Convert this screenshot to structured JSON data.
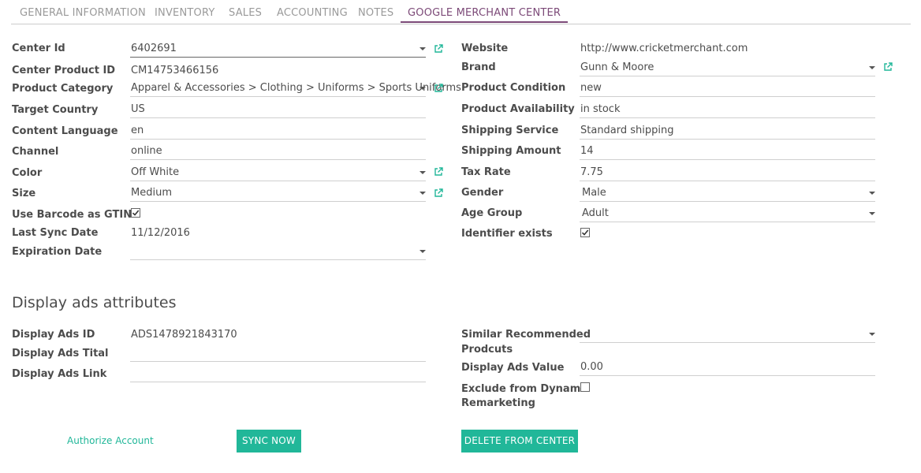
{
  "tabs": [
    "GENERAL INFORMATION",
    "INVENTORY",
    "SALES",
    "ACCOUNTING",
    "NOTES",
    "GOOGLE MERCHANT CENTER"
  ],
  "left": {
    "center_id": {
      "label": "Center Id",
      "value": "6402691"
    },
    "center_product_id": {
      "label": "Center Product ID",
      "value": "CM14753466156"
    },
    "product_category": {
      "label": "Product Category",
      "value": "Apparel & Accessories > Clothing > Uniforms > Sports Uniforms"
    },
    "target_country": {
      "label": "Target Country",
      "value": "US"
    },
    "content_language": {
      "label": "Content Language",
      "value": "en"
    },
    "channel": {
      "label": "Channel",
      "value": "online"
    },
    "color": {
      "label": "Color",
      "value": "Off White"
    },
    "size": {
      "label": "Size",
      "value": "Medium"
    },
    "use_barcode": {
      "label": "Use Barcode as GTIN",
      "checked": true
    },
    "last_sync": {
      "label": "Last Sync Date",
      "value": "11/12/2016"
    },
    "expiration": {
      "label": "Expiration Date",
      "value": ""
    }
  },
  "right": {
    "website": {
      "label": "Website",
      "value": "http://www.cricketmerchant.com"
    },
    "brand": {
      "label": "Brand",
      "value": "Gunn & Moore"
    },
    "condition": {
      "label": "Product Condition",
      "value": "new"
    },
    "availability": {
      "label": "Product Availability",
      "value": "in stock"
    },
    "shipping_service": {
      "label": "Shipping Service",
      "value": "Standard shipping"
    },
    "shipping_amount": {
      "label": "Shipping Amount",
      "value": "14"
    },
    "tax_rate": {
      "label": "Tax Rate",
      "value": "7.75"
    },
    "gender": {
      "label": "Gender",
      "value": "Male"
    },
    "age_group": {
      "label": "Age Group",
      "value": "Adult"
    },
    "identifier": {
      "label": "Identifier exists",
      "checked": true
    }
  },
  "display_ads": {
    "title": "Display ads attributes",
    "id": {
      "label": "Display Ads ID",
      "value": "ADS1478921843170"
    },
    "tital": {
      "label": "Display Ads Tital",
      "value": ""
    },
    "link": {
      "label": "Display Ads Link",
      "value": ""
    },
    "similar_line1": "Similar Recommended",
    "similar_line2": "Prodcuts",
    "similar_value": "",
    "value": {
      "label": "Display Ads Value",
      "value": "0.00"
    },
    "exclude_line1": "Exclude from Dynamic",
    "exclude_line2": "Remarketing",
    "exclude_checked": false
  },
  "actions": {
    "authorize": "Authorize Account",
    "sync": "SYNC NOW",
    "delete": "DELETE FROM CENTER"
  },
  "colors": {
    "accent": "#21b799",
    "tab_active": "#7c4a78"
  }
}
